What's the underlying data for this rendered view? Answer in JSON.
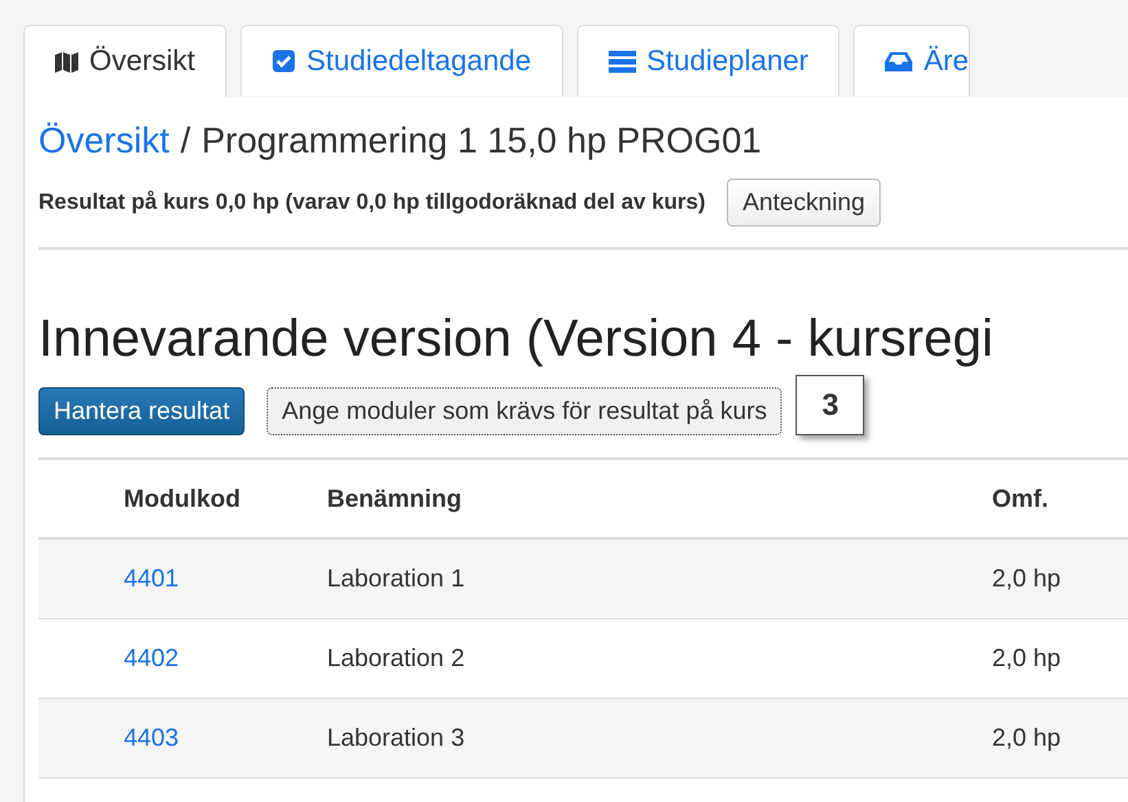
{
  "tabs": [
    {
      "label": "Översikt",
      "kind": "map",
      "selected": true
    },
    {
      "label": "Studiedeltagande",
      "kind": "check",
      "selected": false
    },
    {
      "label": "Studieplaner",
      "kind": "list",
      "selected": false
    },
    {
      "label": "Äre",
      "kind": "inbox",
      "selected": false
    }
  ],
  "breadcrumb": {
    "link": "Översikt",
    "separator": "/",
    "current": "Programmering 1 15,0 hp PROG01"
  },
  "result_summary": "Resultat på kurs 0,0 hp (varav 0,0 hp tillgodoräknad del av kurs)",
  "note_button": "Anteckning",
  "section_heading": "Innevarande version (Version 4 - kursregi",
  "buttons": [
    {
      "label": "Hantera resultat",
      "kind": "primary"
    },
    {
      "label": "Ange moduler som krävs för resultat på kurs",
      "kind": "default"
    }
  ],
  "callout": "3",
  "table": {
    "columns": [
      "Modulkod",
      "Benämning",
      "Omf."
    ],
    "rows": [
      [
        "4401",
        "Laboration 1",
        "2,0 hp"
      ],
      [
        "4402",
        "Laboration 2",
        "2,0 hp"
      ],
      [
        "4403",
        "Laboration 3",
        "2,0 hp"
      ]
    ]
  }
}
